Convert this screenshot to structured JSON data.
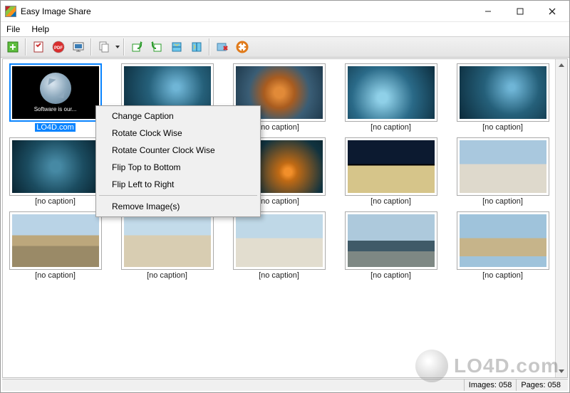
{
  "window": {
    "title": "Easy Image Share"
  },
  "menu": {
    "file": "File",
    "help": "Help"
  },
  "toolbar": {
    "icons": {
      "add": "add-image-icon",
      "options": "options-icon",
      "pdf": "pdf-icon",
      "slideshow": "slideshow-icon",
      "copy": "copy-icon",
      "rotate_cw": "rotate-cw-icon",
      "rotate_ccw": "rotate-ccw-icon",
      "flip_v": "flip-vertical-icon",
      "flip_h": "flip-horizontal-icon",
      "remove": "remove-icon",
      "help": "help-icon"
    }
  },
  "context_menu": {
    "items": [
      "Change Caption",
      "Rotate Clock Wise",
      "Rotate Counter Clock Wise",
      "Flip Top to Bottom",
      "Flip Left to Right"
    ],
    "separator_then": "Remove Image(s)"
  },
  "thumbnails": [
    {
      "caption": "LO4D.com",
      "selected": true,
      "kind": "logo",
      "subtag": "Software is our..."
    },
    {
      "caption": "",
      "selected": false,
      "kind": "underwater"
    },
    {
      "caption": "[no caption]",
      "selected": false,
      "kind": "starfish"
    },
    {
      "caption": "[no caption]",
      "selected": false,
      "kind": "underwater2"
    },
    {
      "caption": "[no caption]",
      "selected": false,
      "kind": "underwater"
    },
    {
      "caption": "[no caption]",
      "selected": false,
      "kind": "underwater3"
    },
    {
      "caption": "",
      "selected": false,
      "kind": "underwater2"
    },
    {
      "caption": "[no caption]",
      "selected": false,
      "kind": "clownfish"
    },
    {
      "caption": "[no caption]",
      "selected": false,
      "kind": "arch"
    },
    {
      "caption": "[no caption]",
      "selected": false,
      "kind": "palace"
    },
    {
      "caption": "[no caption]",
      "selected": false,
      "kind": "plaza1"
    },
    {
      "caption": "[no caption]",
      "selected": false,
      "kind": "plaza2"
    },
    {
      "caption": "[no caption]",
      "selected": false,
      "kind": "plaza3"
    },
    {
      "caption": "[no caption]",
      "selected": false,
      "kind": "waterfront"
    },
    {
      "caption": "[no caption]",
      "selected": false,
      "kind": "tower"
    }
  ],
  "status": {
    "images_label": "Images:",
    "images_value": "058",
    "pages_label": "Pages:",
    "pages_value": "058"
  },
  "watermark": "LO4D.com"
}
